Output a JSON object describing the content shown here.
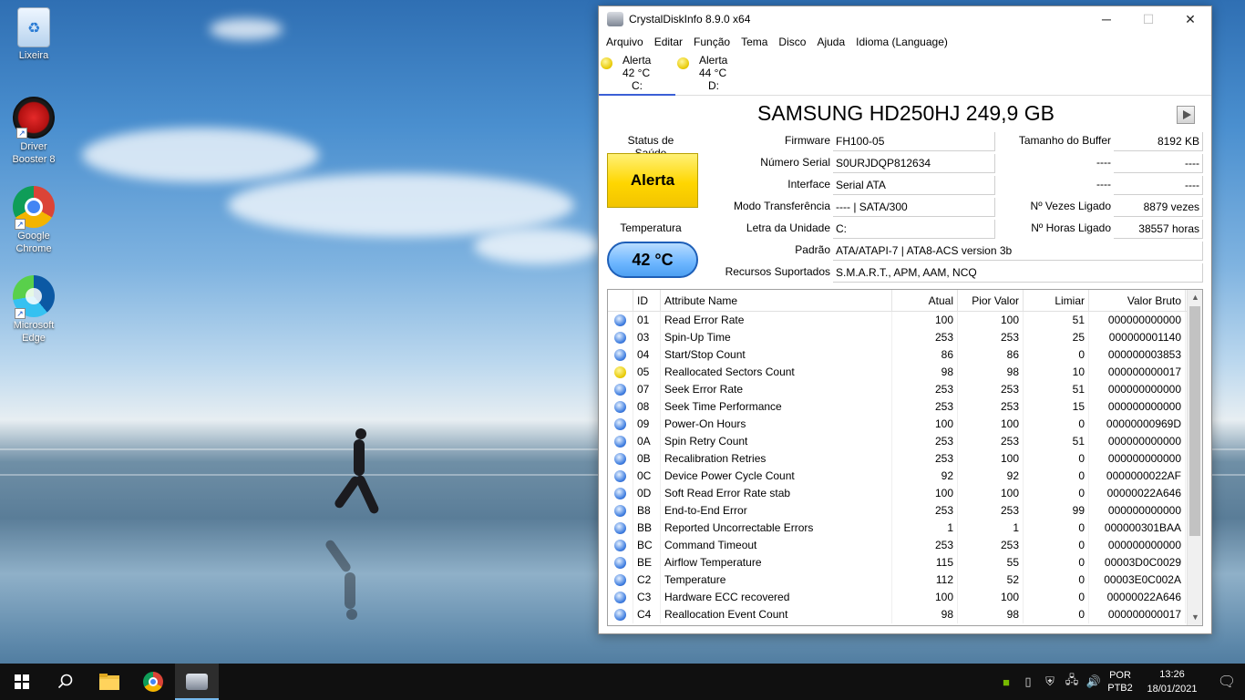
{
  "desktop": {
    "icons": [
      {
        "label": "Lixeira"
      },
      {
        "label": "Driver Booster 8"
      },
      {
        "label": "Google Chrome"
      },
      {
        "label": "Microsoft Edge"
      }
    ]
  },
  "window": {
    "title": "CrystalDiskInfo 8.9.0 x64",
    "controls": {
      "minimize": "─",
      "maximize": "☐",
      "close": "✕"
    },
    "menu": [
      "Arquivo",
      "Editar",
      "Função",
      "Tema",
      "Disco",
      "Ajuda",
      "Idioma (Language)"
    ],
    "drives": [
      {
        "status": "Alerta",
        "temp": "42 °C",
        "letter": "C:",
        "active": true
      },
      {
        "status": "Alerta",
        "temp": "44 °C",
        "letter": "D:",
        "active": false
      }
    ],
    "model": "SAMSUNG HD250HJ 249,9 GB",
    "health": {
      "label": "Status de Saúde",
      "value": "Alerta",
      "color": "#ffd600"
    },
    "temperature": {
      "label": "Temperatura",
      "value": "42 °C"
    },
    "info": {
      "firmware_label": "Firmware",
      "firmware": "FH100-05",
      "serial_label": "Número Serial",
      "serial": "S0URJDQP812634",
      "interface_label": "Interface",
      "interface": "Serial ATA",
      "transfer_label": "Modo Transferência",
      "transfer": "---- | SATA/300",
      "drive_letter_label": "Letra da Unidade",
      "drive_letter": "C:",
      "standard_label": "Padrão",
      "standard": "ATA/ATAPI-7 | ATA8-ACS version 3b",
      "features_label": "Recursos Suportados",
      "features": "S.M.A.R.T., APM, AAM, NCQ",
      "buffer_label": "Tamanho do Buffer",
      "buffer": "8192 KB",
      "blank1_label": "----",
      "blank1": "----",
      "blank2_label": "----",
      "blank2": "----",
      "power_count_label": "Nº Vezes Ligado",
      "power_count": "8879 vezes",
      "power_hours_label": "Nº Horas Ligado",
      "power_hours": "38557 horas"
    },
    "table": {
      "headers": {
        "id": "ID",
        "name": "Attribute Name",
        "current": "Atual",
        "worst": "Pior Valor",
        "threshold": "Limiar",
        "raw": "Valor Bruto"
      },
      "rows": [
        {
          "status": "good",
          "id": "01",
          "name": "Read Error Rate",
          "current": "100",
          "worst": "100",
          "threshold": "51",
          "raw": "000000000000"
        },
        {
          "status": "good",
          "id": "03",
          "name": "Spin-Up Time",
          "current": "253",
          "worst": "253",
          "threshold": "25",
          "raw": "000000001140"
        },
        {
          "status": "good",
          "id": "04",
          "name": "Start/Stop Count",
          "current": "86",
          "worst": "86",
          "threshold": "0",
          "raw": "000000003853"
        },
        {
          "status": "caution",
          "id": "05",
          "name": "Reallocated Sectors Count",
          "current": "98",
          "worst": "98",
          "threshold": "10",
          "raw": "000000000017"
        },
        {
          "status": "good",
          "id": "07",
          "name": "Seek Error Rate",
          "current": "253",
          "worst": "253",
          "threshold": "51",
          "raw": "000000000000"
        },
        {
          "status": "good",
          "id": "08",
          "name": "Seek Time Performance",
          "current": "253",
          "worst": "253",
          "threshold": "15",
          "raw": "000000000000"
        },
        {
          "status": "good",
          "id": "09",
          "name": "Power-On Hours",
          "current": "100",
          "worst": "100",
          "threshold": "0",
          "raw": "00000000969D"
        },
        {
          "status": "good",
          "id": "0A",
          "name": "Spin Retry Count",
          "current": "253",
          "worst": "253",
          "threshold": "51",
          "raw": "000000000000"
        },
        {
          "status": "good",
          "id": "0B",
          "name": "Recalibration Retries",
          "current": "253",
          "worst": "100",
          "threshold": "0",
          "raw": "000000000000"
        },
        {
          "status": "good",
          "id": "0C",
          "name": "Device Power Cycle Count",
          "current": "92",
          "worst": "92",
          "threshold": "0",
          "raw": "0000000022AF"
        },
        {
          "status": "good",
          "id": "0D",
          "name": "Soft Read Error Rate stab",
          "current": "100",
          "worst": "100",
          "threshold": "0",
          "raw": "00000022A646"
        },
        {
          "status": "good",
          "id": "B8",
          "name": "End-to-End Error",
          "current": "253",
          "worst": "253",
          "threshold": "99",
          "raw": "000000000000"
        },
        {
          "status": "good",
          "id": "BB",
          "name": "Reported Uncorrectable Errors",
          "current": "1",
          "worst": "1",
          "threshold": "0",
          "raw": "000000301BAA"
        },
        {
          "status": "good",
          "id": "BC",
          "name": "Command Timeout",
          "current": "253",
          "worst": "253",
          "threshold": "0",
          "raw": "000000000000"
        },
        {
          "status": "good",
          "id": "BE",
          "name": "Airflow Temperature",
          "current": "115",
          "worst": "55",
          "threshold": "0",
          "raw": "00003D0C0029"
        },
        {
          "status": "good",
          "id": "C2",
          "name": "Temperature",
          "current": "112",
          "worst": "52",
          "threshold": "0",
          "raw": "00003E0C002A"
        },
        {
          "status": "good",
          "id": "C3",
          "name": "Hardware ECC recovered",
          "current": "100",
          "worst": "100",
          "threshold": "0",
          "raw": "00000022A646"
        },
        {
          "status": "good",
          "id": "C4",
          "name": "Reallocation Event Count",
          "current": "98",
          "worst": "98",
          "threshold": "0",
          "raw": "000000000017"
        }
      ]
    }
  },
  "taskbar": {
    "language": "POR",
    "layout": "PTB2",
    "time": "13:26",
    "date": "18/01/2021"
  }
}
